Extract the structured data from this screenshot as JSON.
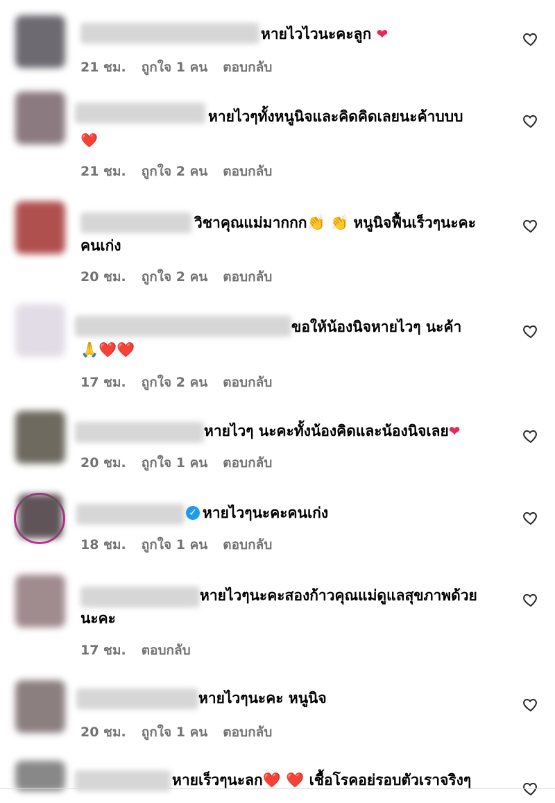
{
  "comments": [
    {
      "text": "หายไวไวนะคะลูก ",
      "emoji": "❤️",
      "line2": "",
      "time": "21 ชม.",
      "likes": "ถูกใจ 1 คน",
      "reply": "ตอบกลับ",
      "avatar_color": "#6d6a72"
    },
    {
      "text": "หายไวๆทั้งหนูนิจและคิดคิดเลยนะค้าบบบ",
      "emoji": "",
      "line2": "❤️",
      "time": "21 ชม.",
      "likes": "ถูกใจ 2 คน",
      "reply": "ตอบกลับ",
      "avatar_color": "#8b7a80"
    },
    {
      "text": "วิชาคุณแม่มากกก👏 👏 หนูนิจฟื้นเร็วๆนะคะ",
      "emoji": "",
      "line2": "คนเก่ง",
      "time": "20 ชม.",
      "likes": "ถูกใจ 2 คน",
      "reply": "ตอบกลับ",
      "avatar_color": "#b0504e"
    },
    {
      "text": "ขอให้น้องนิจหายไวๆ นะค้า",
      "emoji": "",
      "line2": "🙏❤️❤️",
      "time": "17 ชม.",
      "likes": "ถูกใจ 2 คน",
      "reply": "ตอบกลับ",
      "avatar_color": "#e2dce6"
    },
    {
      "text": "หายไวๆ นะคะทั้งน้องคิดและน้องนิจเลย",
      "emoji": "❤️",
      "line2": "",
      "time": "20 ชม.",
      "likes": "ถูกใจ 1 คน",
      "reply": "ตอบกลับ",
      "avatar_color": "#6e6a60"
    },
    {
      "text": "หายไวๆนะคะคนเก่ง",
      "emoji": "",
      "line2": "",
      "time": "18 ชม.",
      "likes": "ถูกใจ 1 คน",
      "reply": "ตอบกลับ",
      "avatar_color": "#5f5558"
    },
    {
      "text": "หายไวๆนะคะสองก้าวคุณแม่ดูแลสุขภาพด้วย",
      "emoji": "",
      "line2": "นะคะ",
      "time": "17 ชม.",
      "likes": "",
      "reply": "ตอบกลับ",
      "avatar_color": "#a08b8f"
    },
    {
      "text": "หายไวๆนะคะ หนูนิจ",
      "emoji": "",
      "line2": "",
      "time": "20 ชม.",
      "likes": "ถูกใจ 1 คน",
      "reply": "ตอบกลับ",
      "avatar_color": "#8c7f80"
    },
    {
      "text": "หายเร็วๆนะลก",
      "emoji": "❤️ ❤️ เชื้อโรคอย่รอบตัวเราจริงๆ",
      "line2": "",
      "time": "",
      "likes": "",
      "reply": "",
      "avatar_color": "#888888"
    }
  ],
  "icons": {
    "like": "heart-outline-icon",
    "verified": "verified-badge-icon"
  },
  "colors": {
    "meta": "#737373",
    "heart": "#e8275a",
    "verified": "#1d9bf0"
  }
}
